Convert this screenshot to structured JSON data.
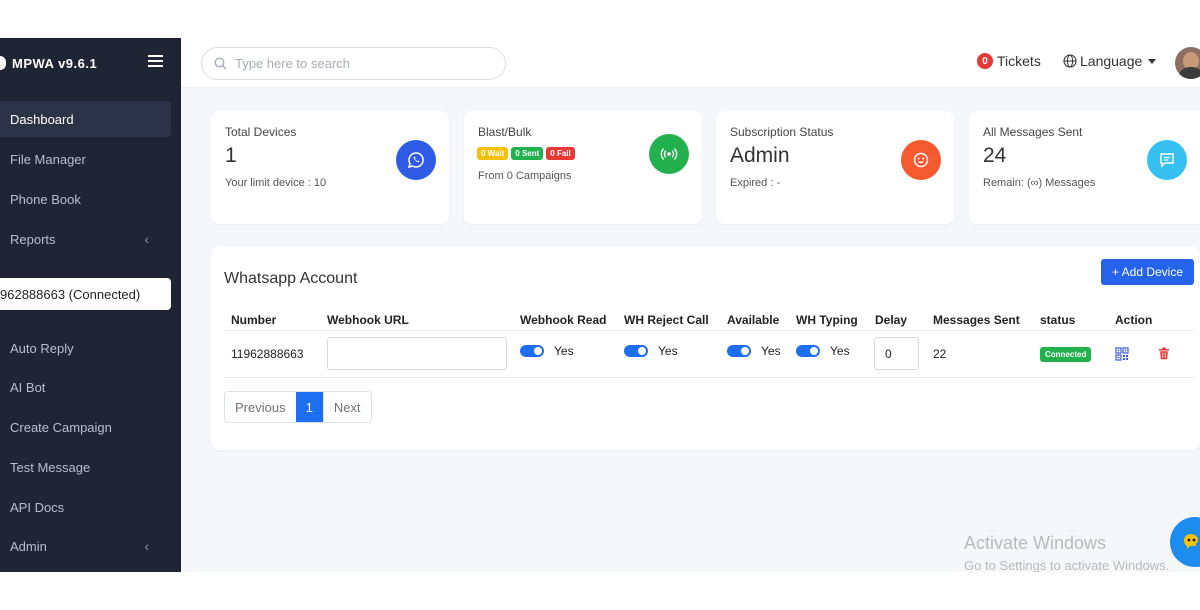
{
  "sidebar": {
    "brand": "MPWA v9.6.1",
    "items": [
      {
        "label": "Dashboard"
      },
      {
        "label": "File Manager"
      },
      {
        "label": "Phone Book"
      },
      {
        "label": "Reports"
      },
      {
        "label": "Auto Reply"
      },
      {
        "label": "AI Bot"
      },
      {
        "label": "Create Campaign"
      },
      {
        "label": "Test Message"
      },
      {
        "label": "API Docs"
      },
      {
        "label": "Admin"
      }
    ],
    "device_selector": "962888663 (Connected)"
  },
  "topbar": {
    "search_placeholder": "Type here to search",
    "tickets_count": "0",
    "tickets_label": "Tickets",
    "language_label": "Language"
  },
  "stats": [
    {
      "label": "Total Devices",
      "value": "1",
      "sub": "Your limit device : 10",
      "icon": "whatsapp-icon",
      "color": "#2f5be7"
    },
    {
      "label": "Blast/Bulk",
      "pills": [
        {
          "text": "0 Wait",
          "color": "#f4c20d"
        },
        {
          "text": "0 Sent",
          "color": "#22b14c"
        },
        {
          "text": "0 Fail",
          "color": "#e53935"
        }
      ],
      "sub": "From 0 Campaigns",
      "icon": "broadcast-icon",
      "color": "#22b14c"
    },
    {
      "label": "Subscription Status",
      "value": "Admin",
      "sub": "Expired : -",
      "icon": "smile-icon",
      "color": "#f4592f"
    },
    {
      "label": "All Messages Sent",
      "value": "24",
      "sub": "Remain: (∞) Messages",
      "icon": "message-icon",
      "color": "#36c0f0"
    }
  ],
  "accounts": {
    "title": "Whatsapp Account",
    "add_button": "+ Add Device",
    "columns": [
      "Number",
      "Webhook URL",
      "Webhook Read",
      "WH Reject Call",
      "Available",
      "WH Typing",
      "Delay",
      "Messages Sent",
      "status",
      "Action"
    ],
    "rows": [
      {
        "number": "11962888663",
        "webhook_url": "",
        "webhook_read": "Yes",
        "wh_reject_call": "Yes",
        "available": "Yes",
        "wh_typing": "Yes",
        "delay": "0",
        "messages_sent": "22",
        "status": "Connected"
      }
    ],
    "pager": {
      "previous": "Previous",
      "current": "1",
      "next": "Next"
    }
  },
  "watermark": {
    "line1": "Activate Windows",
    "line2": "Go to Settings to activate Windows."
  }
}
